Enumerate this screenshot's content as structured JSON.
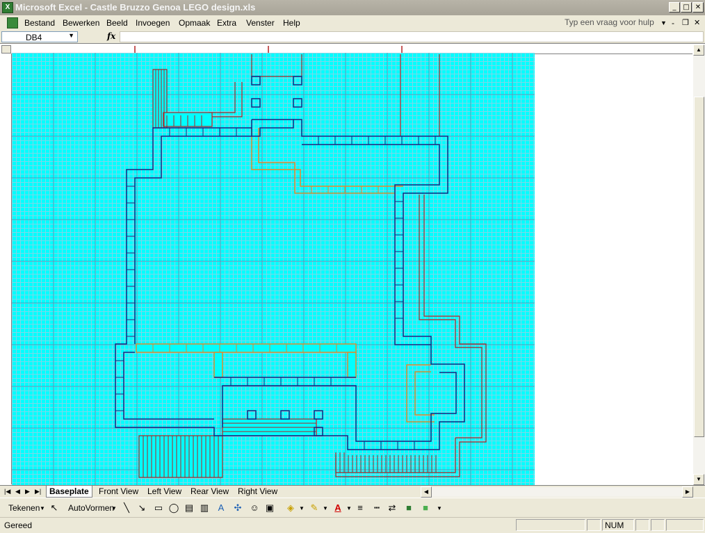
{
  "window": {
    "title": "Microsoft Excel - Castle Bruzzo Genoa LEGO design.xls",
    "app_icon": "excel-icon"
  },
  "menu": {
    "items": [
      "Bestand",
      "Bewerken",
      "Beeld",
      "Invoegen",
      "Opmaak",
      "Extra",
      "Venster",
      "Help"
    ],
    "help_placeholder": "Typ een vraag voor hulp"
  },
  "formula_bar": {
    "name_box": "DB4",
    "fx": "fx",
    "formula": ""
  },
  "sheet_tabs": {
    "tabs": [
      "Baseplate",
      "Front View",
      "Left View",
      "Rear View",
      "Right View"
    ],
    "active": "Baseplate"
  },
  "drawing_toolbar": {
    "tekenen": "Tekenen",
    "autovormen": "AutoVormen"
  },
  "status": {
    "left": "Gereed",
    "num": "NUM"
  },
  "colors": {
    "grid_bg": "#00ffff",
    "wall_navy": "#1a237e",
    "wall_orange": "#e08a2a",
    "wall_red": "#b22222"
  }
}
